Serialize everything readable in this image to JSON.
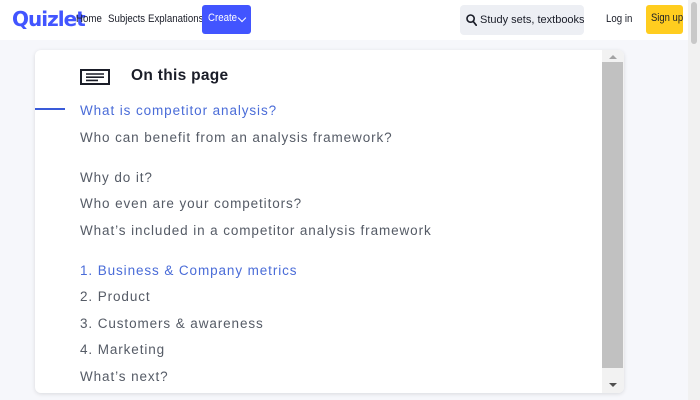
{
  "nav": {
    "logo": "Quizlet",
    "links": [
      "Home",
      "Subjects",
      "Explanations"
    ],
    "create_label": "Create",
    "search_placeholder": "Study sets, textbooks, ...",
    "login_label": "Log in",
    "signup_label": "Sign up",
    "brand_color": "#4255ff",
    "signup_color": "#ffcd1f"
  },
  "panel": {
    "icon": "document-lines-icon",
    "title": "On this page",
    "items": [
      "What is competitor analysis?",
      "Who can benefit from an analysis framework?",
      "Why do it?",
      "Who even are your competitors?",
      "What’s included in a competitor analysis framework",
      "1. Business & Company metrics",
      "2. Product",
      "3. Customers & awareness",
      "4. Marketing",
      "What’s next?"
    ],
    "active_color": "#4a6cd8"
  }
}
